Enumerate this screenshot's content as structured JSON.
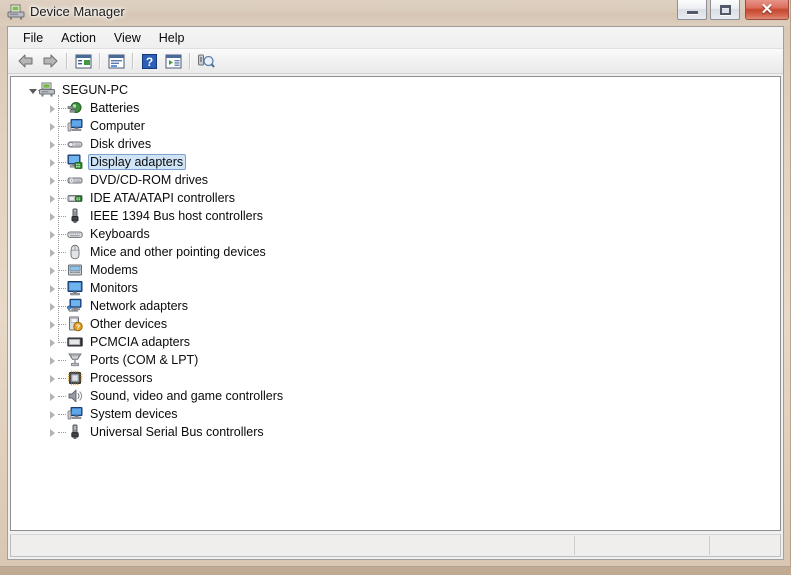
{
  "window": {
    "title": "Device Manager",
    "title_icon": "device-manager-icon",
    "controls": {
      "minimize_label": "Minimize",
      "maximize_label": "Maximize",
      "close_label": "Close",
      "close_glyph": "✕"
    },
    "accent_close_color": "#c6462f",
    "frame_color": "#d8c8b4"
  },
  "menubar": {
    "items": [
      {
        "label": "File",
        "name": "menu-file"
      },
      {
        "label": "Action",
        "name": "menu-action"
      },
      {
        "label": "View",
        "name": "menu-view"
      },
      {
        "label": "Help",
        "name": "menu-help"
      }
    ]
  },
  "toolbar": {
    "buttons": [
      {
        "name": "back-arrow-icon",
        "tooltip": "Back"
      },
      {
        "name": "forward-arrow-icon",
        "tooltip": "Forward"
      },
      {
        "name": "show-console-tree-icon",
        "tooltip": "Show/Hide Console Tree"
      },
      {
        "name": "properties-icon",
        "tooltip": "Properties"
      },
      {
        "name": "help-icon",
        "tooltip": "Help"
      },
      {
        "name": "update-driver-icon",
        "tooltip": "Update Driver Software"
      },
      {
        "name": "scan-hardware-changes-icon",
        "tooltip": "Scan for hardware changes"
      }
    ]
  },
  "tree": {
    "root": {
      "label": "SEGUN-PC",
      "icon": "computer-root-icon",
      "expanded": true,
      "selected": false
    },
    "items": [
      {
        "label": "Batteries",
        "icon": "battery-icon",
        "expanded": false,
        "selected": false
      },
      {
        "label": "Computer",
        "icon": "computer-icon",
        "expanded": false,
        "selected": false
      },
      {
        "label": "Disk drives",
        "icon": "disk-drive-icon",
        "expanded": false,
        "selected": false
      },
      {
        "label": "Display adapters",
        "icon": "display-adapter-icon",
        "expanded": false,
        "selected": true
      },
      {
        "label": "DVD/CD-ROM drives",
        "icon": "dvd-drive-icon",
        "expanded": false,
        "selected": false
      },
      {
        "label": "IDE ATA/ATAPI controllers",
        "icon": "ide-controller-icon",
        "expanded": false,
        "selected": false
      },
      {
        "label": "IEEE 1394 Bus host controllers",
        "icon": "firewire-icon",
        "expanded": false,
        "selected": false
      },
      {
        "label": "Keyboards",
        "icon": "keyboard-icon",
        "expanded": false,
        "selected": false
      },
      {
        "label": "Mice and other pointing devices",
        "icon": "mouse-icon",
        "expanded": false,
        "selected": false
      },
      {
        "label": "Modems",
        "icon": "modem-icon",
        "expanded": false,
        "selected": false
      },
      {
        "label": "Monitors",
        "icon": "monitor-icon",
        "expanded": false,
        "selected": false
      },
      {
        "label": "Network adapters",
        "icon": "network-adapter-icon",
        "expanded": false,
        "selected": false
      },
      {
        "label": "Other devices",
        "icon": "other-device-icon",
        "expanded": false,
        "selected": false
      },
      {
        "label": "PCMCIA adapters",
        "icon": "pcmcia-icon",
        "expanded": false,
        "selected": false
      },
      {
        "label": "Ports (COM & LPT)",
        "icon": "port-icon",
        "expanded": false,
        "selected": false
      },
      {
        "label": "Processors",
        "icon": "processor-icon",
        "expanded": false,
        "selected": false
      },
      {
        "label": "Sound, video and game controllers",
        "icon": "sound-icon",
        "expanded": false,
        "selected": false
      },
      {
        "label": "System devices",
        "icon": "system-device-icon",
        "expanded": false,
        "selected": false
      },
      {
        "label": "Universal Serial Bus controllers",
        "icon": "usb-icon",
        "expanded": false,
        "selected": false
      }
    ]
  },
  "statusbar": {
    "main": "",
    "middle": "",
    "right": ""
  }
}
